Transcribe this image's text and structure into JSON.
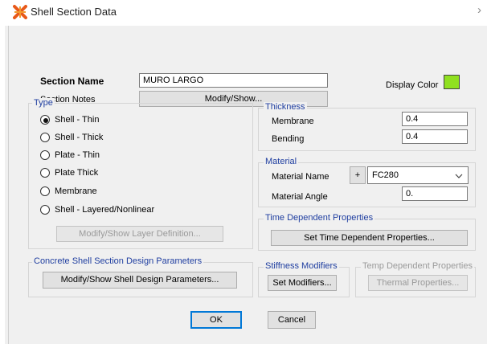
{
  "window": {
    "title": "Shell Section Data",
    "close_glyph": "›",
    "icon": "shell-app-icon"
  },
  "section": {
    "name_label": "Section Name",
    "name_value": "MURO LARGO",
    "notes_label": "Section Notes",
    "notes_button": "Modify/Show...",
    "display_color_label": "Display Color",
    "display_color": "#90e020"
  },
  "type": {
    "title": "Type",
    "options": [
      "Shell - Thin",
      "Shell - Thick",
      "Plate - Thin",
      "Plate Thick",
      "Membrane",
      "Shell - Layered/Nonlinear"
    ],
    "selected_index": 0,
    "layer_button": "Modify/Show Layer Definition..."
  },
  "thickness": {
    "title": "Thickness",
    "membrane_label": "Membrane",
    "membrane_value": "0.4",
    "bending_label": "Bending",
    "bending_value": "0.4"
  },
  "material": {
    "title": "Material",
    "name_label": "Material Name",
    "add_button": "+",
    "name_value": "FC280",
    "angle_label": "Material Angle",
    "angle_value": "0."
  },
  "time_dependent": {
    "title": "Time Dependent Properties",
    "button": "Set Time Dependent Properties..."
  },
  "concrete_design": {
    "title": "Concrete Shell Section Design Parameters",
    "button": "Modify/Show Shell Design Parameters..."
  },
  "stiffness": {
    "title": "Stiffness Modifiers",
    "button": "Set Modifiers..."
  },
  "temp_dependent": {
    "title": "Temp Dependent Properties",
    "button": "Thermal Properties..."
  },
  "footer": {
    "ok": "OK",
    "cancel": "Cancel"
  }
}
